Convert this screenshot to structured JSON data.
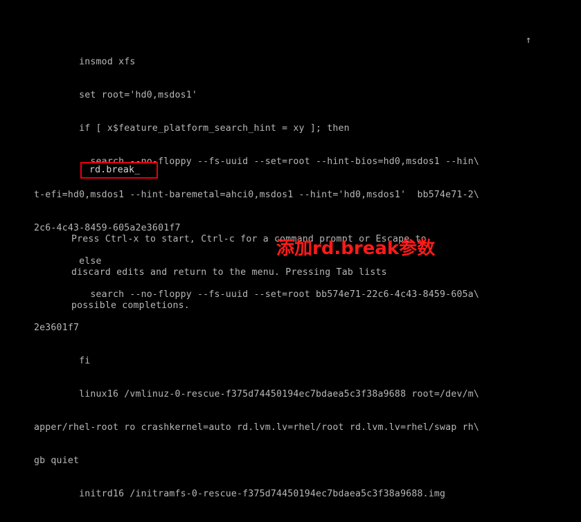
{
  "editor": {
    "lines": [
      "        insmod xfs",
      "        set root='hd0,msdos1'",
      "        if [ x$feature_platform_search_hint = xy ]; then",
      "          search --no-floppy --fs-uuid --set=root --hint-bios=hd0,msdos1 --hin\\",
      "t-efi=hd0,msdos1 --hint-baremetal=ahci0,msdos1 --hint='hd0,msdos1'  bb574e71-2\\",
      "2c6-4c43-8459-605a2e3601f7",
      "        else",
      "          search --no-floppy --fs-uuid --set=root bb574e71-22c6-4c43-8459-605a\\",
      "2e3601f7",
      "        fi",
      "        linux16 /vmlinuz-0-rescue-f375d74450194ec7bdaea5c3f38a9688 root=/dev/m\\",
      "apper/rhel-root ro crashkernel=auto rd.lvm.lv=rhel/root rd.lvm.lv=rhel/swap rh\\",
      "gb quiet",
      "        initrd16 /initramfs-0-rescue-f375d74450194ec7bdaea5c3f38a9688.img"
    ],
    "scroll_indicator": "↑",
    "highlighted_edit": "rd.break_"
  },
  "help_text": [
    "Press Ctrl-x to start, Ctrl-c for a command prompt or Escape to",
    "discard edits and return to the menu. Pressing Tab lists",
    "possible completions."
  ],
  "annotation": "添加rd.break参数",
  "colors": {
    "background": "#000000",
    "terminal_text": "#b8b8b8",
    "annotation_red": "#ff1a1a",
    "box_red": "#e60012"
  }
}
